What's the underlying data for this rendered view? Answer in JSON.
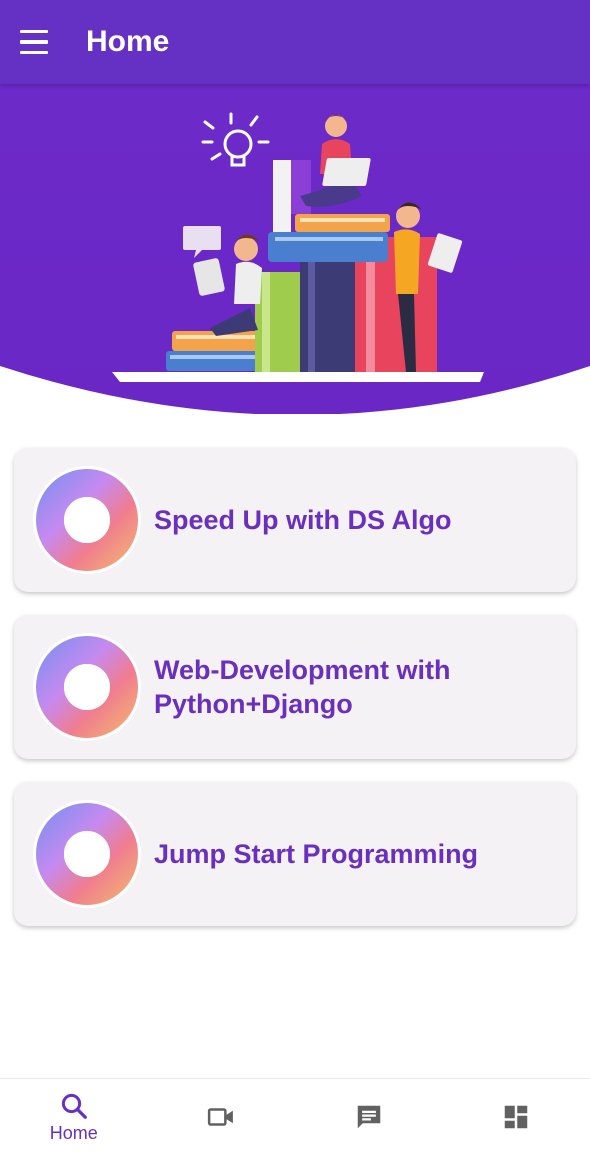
{
  "app_bar": {
    "title": "Home",
    "menu_icon": "hamburger-menu-icon"
  },
  "hero": {
    "illustration": "people-reading-on-books-illustration"
  },
  "courses": [
    {
      "title_lines": [
        "Speed Up with DS Algo"
      ],
      "icon": "ring-logo-icon"
    },
    {
      "title_lines": [
        "Web-Development with",
        "Python+Django"
      ],
      "icon": "ring-logo-icon"
    },
    {
      "title_lines": [
        "Jump Start Programming"
      ],
      "icon": "ring-logo-icon"
    }
  ],
  "bottom_nav": {
    "active_color": "#6530c4",
    "inactive_color": "#616161",
    "items": [
      {
        "label": "Home",
        "icon": "search-icon",
        "active": true
      },
      {
        "label": "",
        "icon": "video-camera-icon",
        "active": false
      },
      {
        "label": "",
        "icon": "chat-message-icon",
        "active": false
      },
      {
        "label": "",
        "icon": "dashboard-icon",
        "active": false
      }
    ]
  },
  "colors": {
    "primary": "#6530c4",
    "hero_bg": "#6a28c8",
    "card_title": "#6a2fbf",
    "card_bg": "#f4f2f4"
  }
}
